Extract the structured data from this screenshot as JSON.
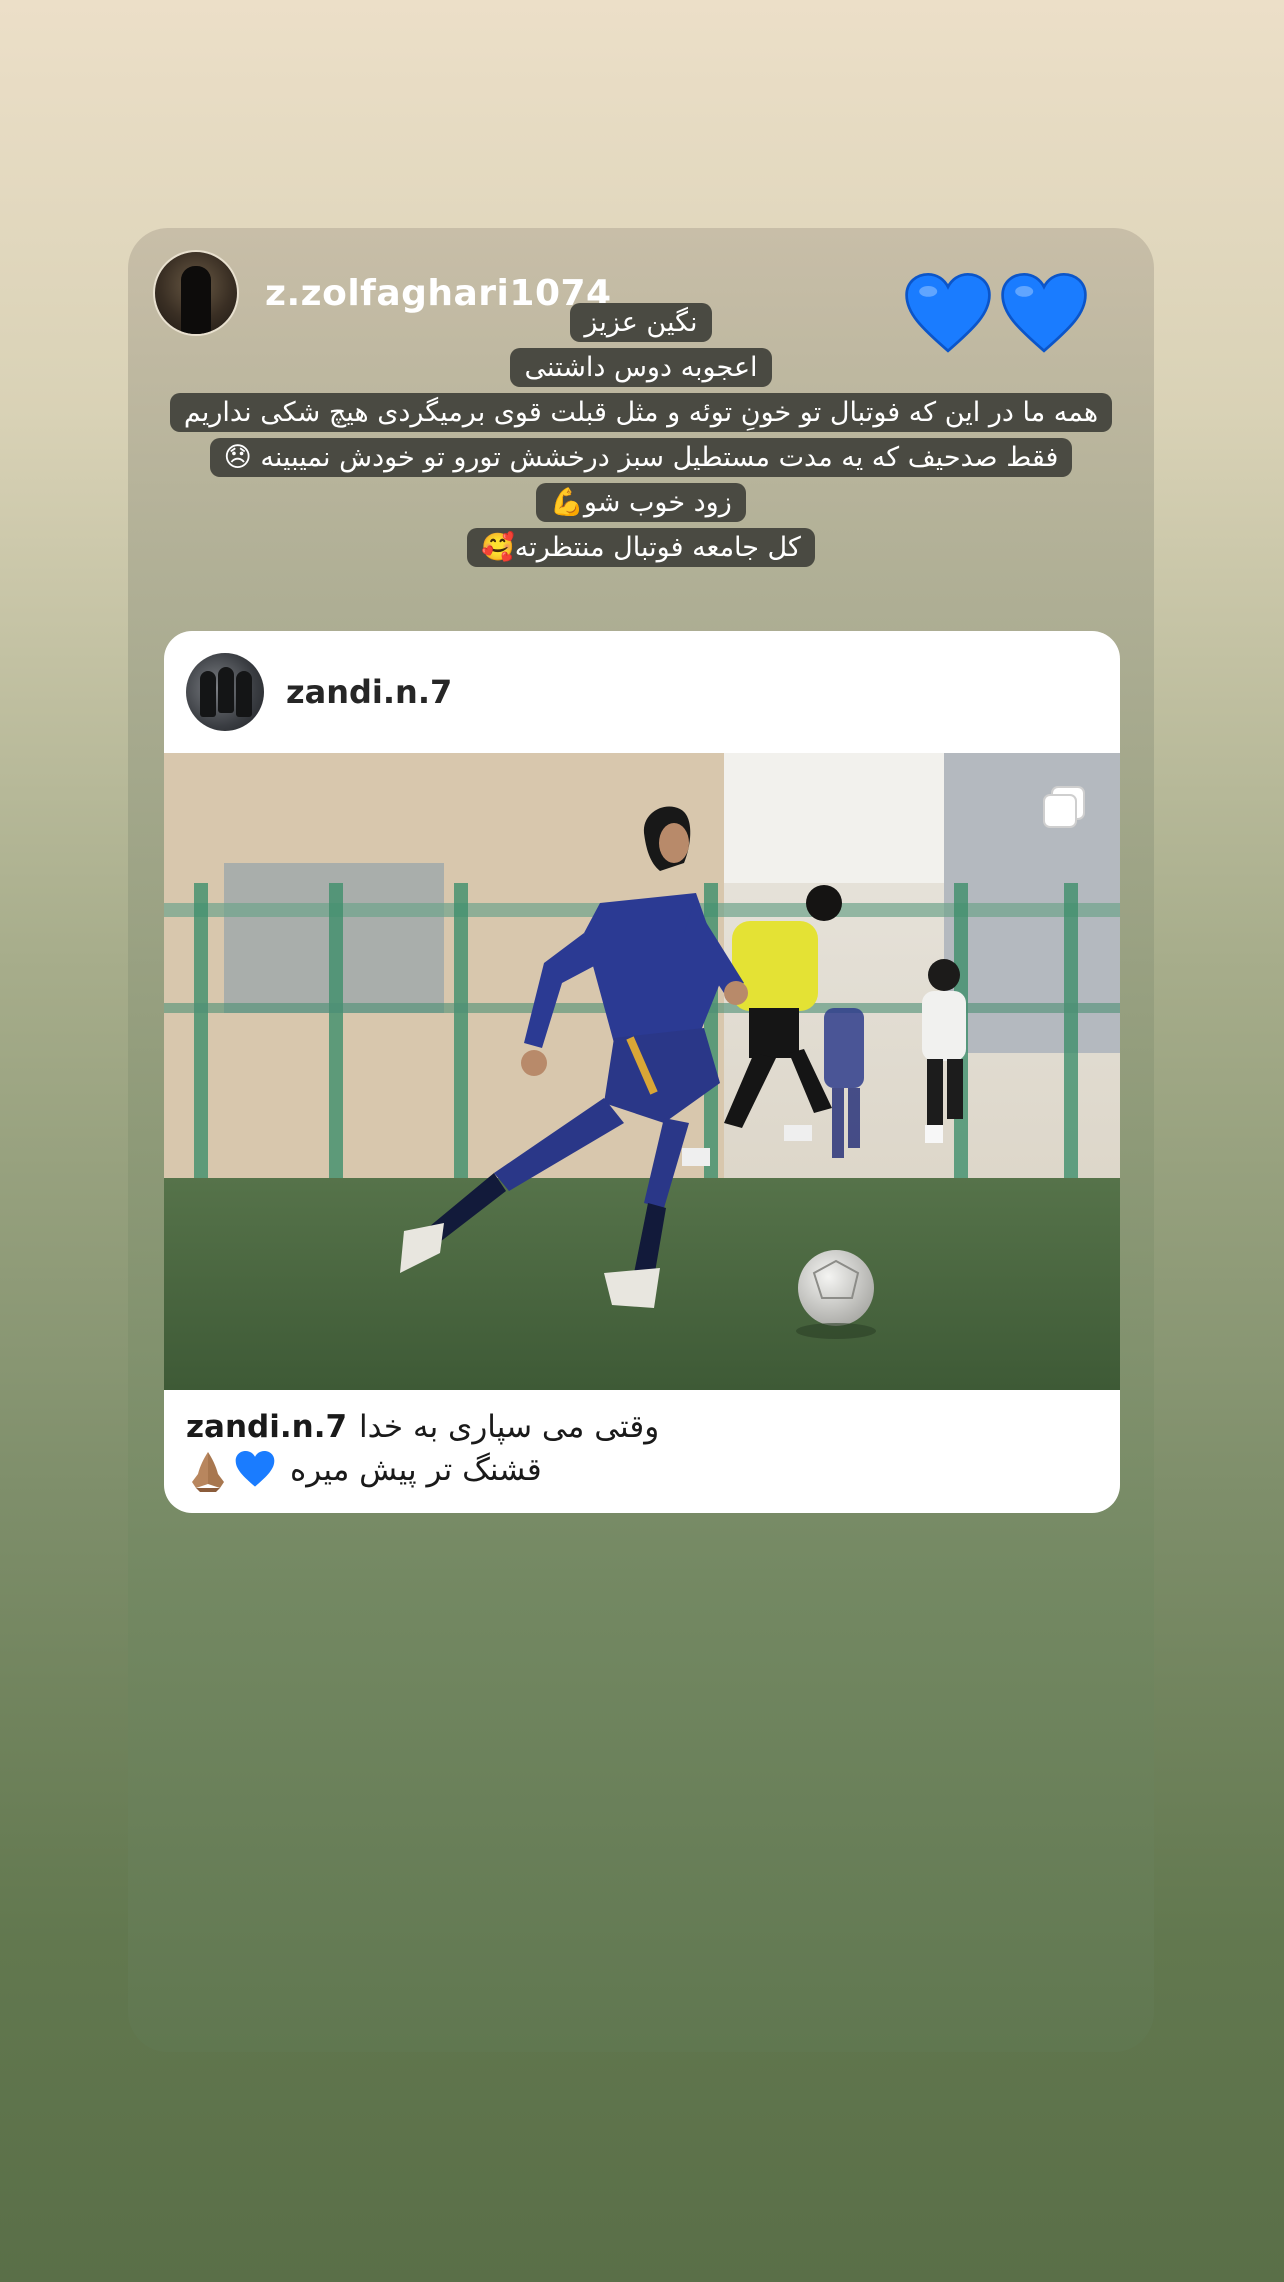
{
  "story": {
    "username": "z.zolfaghari1074",
    "hearts": [
      "blue-heart",
      "blue-heart"
    ],
    "heart_color": "#1a7cff",
    "caption_lines": [
      "نگین عزیز",
      "اعجوبه دوس داشتنی",
      "همه ما در این که فوتبال تو خونِ توئه و مثل قبلت قوی برمیگردی هیچ شکی نداریم",
      "فقط صدحیف که یه مدت مستطیل سبز درخشش تورو تو خودش نمیبینه 😞",
      "زود خوب شو💪",
      "کل جامعه فوتبال منتظرته🥰"
    ]
  },
  "post": {
    "username": "zandi.n.7",
    "multi_icon": "carousel-icon",
    "caption_user": "zandi.n.7",
    "caption_line1": "وقتی می سپاری به خدا",
    "caption_line2": "قشنگ تر پیش میره",
    "caption_emojis": [
      "pray-emoji",
      "blue-heart"
    ]
  }
}
